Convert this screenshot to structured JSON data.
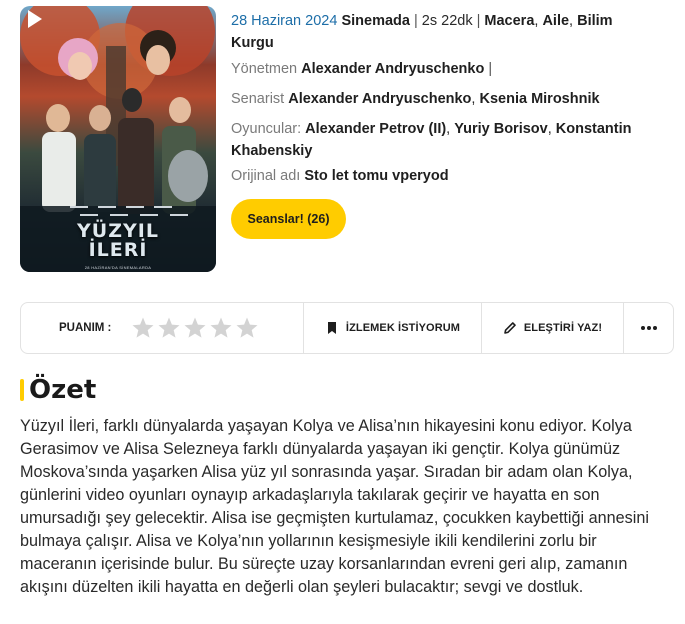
{
  "poster": {
    "title_line1": "YÜZYIL",
    "title_line2": "İLERİ",
    "date_line": "28 HAZİRAN'DA SİNEMALARDA"
  },
  "info": {
    "release_date": "28 Haziran 2024",
    "release_place": "Sinemada",
    "sep1": " | ",
    "duration": "2s 22dk",
    "sep2": " | ",
    "genre1": "Macera",
    "genre2": "Aile",
    "genre3": "Bilim Kurgu",
    "director_label": "Yönetmen",
    "director": "Alexander Andryuschenko",
    "director_trailing": " |",
    "writer_label": "Senarist",
    "writer1": "Alexander Andryuschenko",
    "writer2": "Ksenia Miroshnik",
    "cast_label": "Oyuncular:",
    "cast1": "Alexander Petrov (II)",
    "cast2": "Yuriy Borisov",
    "cast3": "Konstantin Khabenskiy",
    "original_label": "Orijinal adı",
    "original_title": "Sto let tomu vperyod"
  },
  "showtimes_label": "Seanslar! (26)",
  "actions": {
    "rating_label": "PUANIM :",
    "stars_count": 5,
    "watchlist_label": "İZLEMEK İSTİYORUM",
    "review_label": "ELEŞTİRİ YAZ!",
    "more_icon": "ellipsis-icon"
  },
  "summary": {
    "title": "Özet",
    "text": "Yüzyıl İleri, farklı dünyalarda yaşayan Kolya ve Alisa’nın hikayesini konu ediyor. Kolya Gerasimov ve Alisa Selezneya farklı dünyalarda yaşayan iki gençtir.  Kolya günümüz Moskova’sında yaşarken Alisa yüz yıl sonrasında yaşar. Sıradan bir adam olan Kolya, günlerini video oyunları oynayıp arkadaşlarıyla takılarak geçirir ve hayatta en son umursadığı şey gelecektir. Alisa ise geçmişten kurtulamaz, çocukken kaybettiği annesini bulmaya çalışır. Alisa ve Kolya’nın yollarının kesişmesiyle ikili kendilerini zorlu bir maceranın içerisinde bulur. Bu süreçte uzay korsanlarından evreni geri alıp, zamanın akışını düzelten ikili hayatta en değerli olan şeyleri bulacaktır; sevgi ve dostluk."
  },
  "colors": {
    "accent": "#ffcc00",
    "date_blue": "#1d6ea8",
    "star_gray": "#d3d3d3"
  }
}
